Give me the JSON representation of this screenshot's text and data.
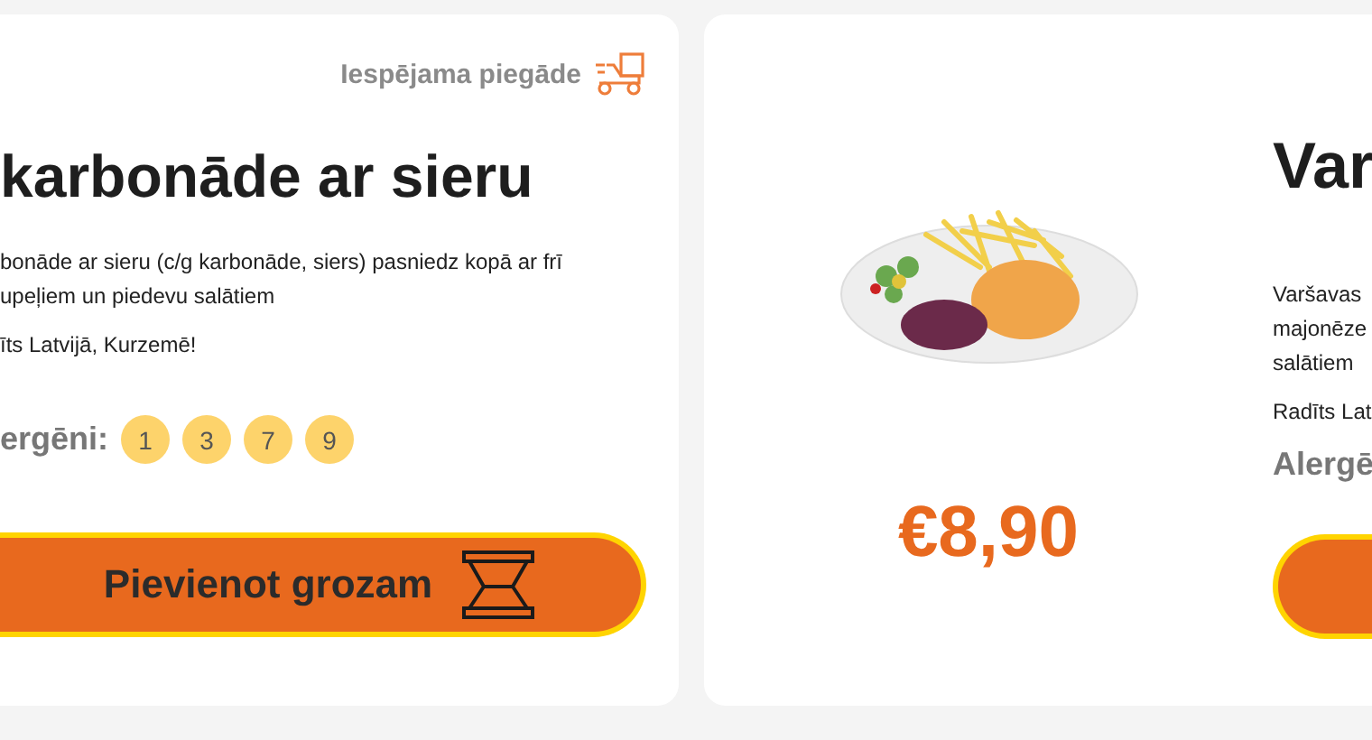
{
  "left_card": {
    "delivery": {
      "label": "Iespējama piegāde"
    },
    "title": "karbonāde ar sieru",
    "description": [
      "bonāde ar sieru (c/g karbonāde, siers) pasniedz kopā ar frī",
      "upeļiem un piedevu salātiem"
    ],
    "origin": "īts Latvijā, Kurzemē!",
    "allergens": {
      "label": "ergēni:",
      "items": [
        "1",
        "3",
        "7",
        "9"
      ]
    },
    "button": {
      "label": "Pievienot grozam"
    }
  },
  "right_card": {
    "price": "€8,90",
    "title": "Var",
    "description": [
      "Varšavas",
      "majonēze",
      "salātiem"
    ],
    "origin": "Radīts Lat",
    "allergens": {
      "label": "Alergē"
    }
  }
}
